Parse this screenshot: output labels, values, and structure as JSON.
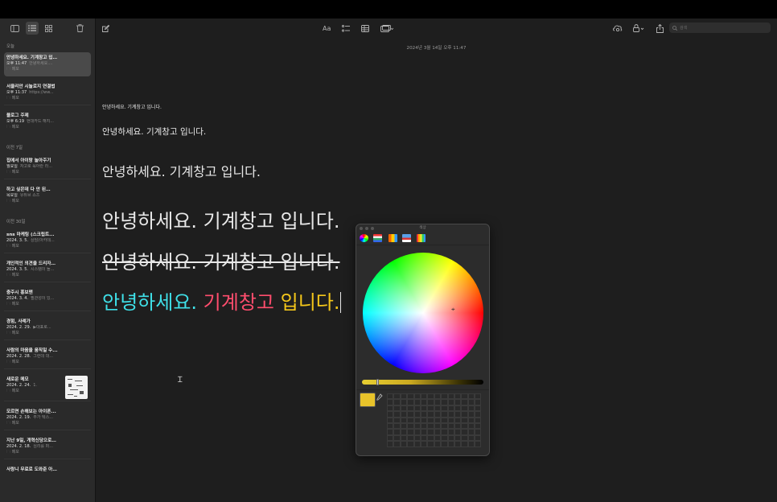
{
  "sidebar": {
    "toolbar": {
      "toggle_icon": "sidebar-icon",
      "list_icon": "list-view-icon",
      "gallery_icon": "gallery-view-icon",
      "delete_icon": "trash-icon"
    },
    "sections": [
      {
        "label": "오늘"
      },
      {
        "label": "이전 7일"
      },
      {
        "label": "이전 30일"
      }
    ],
    "notes": [
      {
        "title": "안녕하세요. 기계창고 입…",
        "date": "오후 11:47",
        "preview": "안녕하세요....",
        "folder": "메모"
      },
      {
        "title": "서울리안 시놀로지 연결법",
        "date": "오후 11:37",
        "preview": "https://ww...",
        "folder": "메모"
      },
      {
        "title": "블로그 주제",
        "date": "오후 6:19",
        "preview": "현대카드 해지...",
        "folder": "메모"
      },
      {
        "title": "집에서 아이랑 놀아주기",
        "date": "월요일",
        "preview": "자고로 육아란 라...",
        "folder": "메모"
      },
      {
        "title": "하고 싶은데 다 안 된…",
        "date": "목요일",
        "preview": "유튜브 쇼츠",
        "folder": "메모"
      },
      {
        "title": "sns 마케팅 (스크립트...",
        "date": "2024. 3. 5.",
        "preview": "상담(아카데...",
        "folder": "메모"
      },
      {
        "title": "개인적인 의견을 드리자…",
        "date": "2024. 3. 5.",
        "preview": "시스템이 돌...",
        "folder": "메모"
      },
      {
        "title": "충주시 홍보맨",
        "date": "2024. 3. 4.",
        "preview": "필관성이 있...",
        "folder": "메모"
      },
      {
        "title": "경험, 사례가",
        "date": "2024. 2. 29.",
        "preview": "▶대표로...",
        "folder": "메모"
      },
      {
        "title": "사람의 마음을 움직일 수...",
        "date": "2024. 2. 28.",
        "preview": "그런데 대...",
        "folder": "메모"
      },
      {
        "title": "새로운 메모",
        "date": "2024. 2. 24.",
        "preview": "1.",
        "folder": "메모"
      },
      {
        "title": "모르면 손해보는 아이폰...",
        "date": "2024. 2. 19.",
        "preview": "추가 텍스...",
        "folder": "메모"
      },
      {
        "title": "지난 9일, 개혁신당으로…",
        "date": "2024. 2. 18.",
        "preview": "심리를 퍼...",
        "folder": "메모"
      },
      {
        "title": "사랑니 무료로 도와준 아…",
        "date": "",
        "preview": "",
        "folder": ""
      }
    ]
  },
  "editor": {
    "toolbar": {
      "compose_icon": "compose-icon",
      "format_label": "Aa",
      "checklist_icon": "checklist-icon",
      "table_icon": "table-icon",
      "media_icon": "media-icon",
      "collab_icon": "collaborate-icon",
      "lock_icon": "lock-icon",
      "share_icon": "share-icon",
      "search_placeholder": "검색"
    },
    "date": "2024년 3월 14일 오후 11:47",
    "lines": [
      "안녕하세요. 기계창고 입니다.",
      "안녕하세요. 기계창고 입니다.",
      "안녕하세요. 기계창고 입니다.",
      "안녕하세요. 기계창고 입니다.",
      "안녕하세요. 기계창고 입니다."
    ],
    "colored_line": {
      "part1": "안녕하세요.",
      "part2": "기계창고",
      "part3": "입니다",
      "part4": ".",
      "color1": "#3fe0e8",
      "color2": "#ff4d6d",
      "color3": "#f5c71a"
    }
  },
  "color_panel": {
    "title": "색상",
    "current_color": "#e8c32a",
    "brightness_fraction": 0.88,
    "modes": [
      "color-wheel-icon",
      "sliders-icon",
      "palettes-icon",
      "image-palettes-icon",
      "pencils-icon"
    ]
  }
}
